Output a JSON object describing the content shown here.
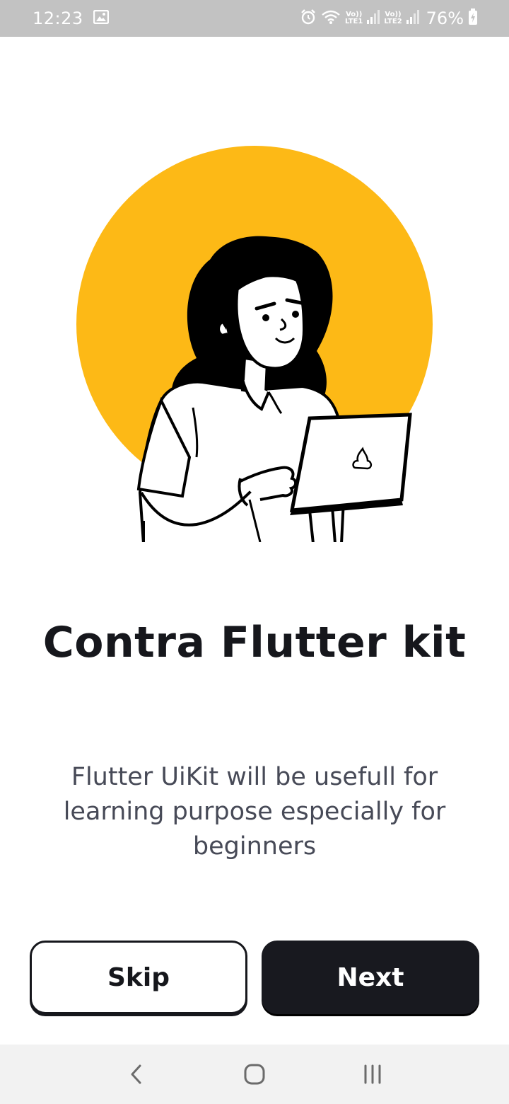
{
  "status_bar": {
    "time": "12:23",
    "sim1_top": "Vo))",
    "sim1_bottom": "LTE1",
    "sim2_top": "Vo))",
    "sim2_bottom": "LTE2",
    "battery_percent": "76%",
    "icons": [
      "gallery-icon",
      "alarm-icon",
      "wifi-icon",
      "signal-icon",
      "battery-charging-icon"
    ]
  },
  "onboarding": {
    "illustration": "woman-with-laptop-illustration",
    "accent_color": "#FDB916",
    "title": "Contra Flutter kit",
    "description": "Flutter UiKit will be usefull for learning purpose especially for beginners"
  },
  "actions": {
    "skip_label": "Skip",
    "next_label": "Next"
  },
  "nav_bar": {
    "icons": [
      "back-icon",
      "home-icon",
      "recents-icon"
    ]
  }
}
